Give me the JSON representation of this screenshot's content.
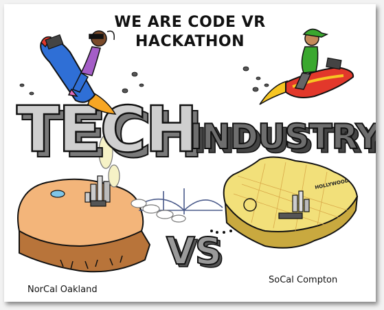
{
  "headline": {
    "line1": "WE ARE CODE VR",
    "line2": "HACKATHON"
  },
  "word_tech": "TECH",
  "word_industry": "INDUSTRY",
  "word_vs": "VS",
  "captions": {
    "left": "NorCal Oakland",
    "right": "SoCal Compton",
    "hollywood_sign": "HOLLYWOOD"
  },
  "colors": {
    "tech_face": "#cfcfcf",
    "industry_face": "#6e6e6e",
    "norcal_land": "#f3b57a",
    "norcal_side": "#b8743a",
    "socal_land": "#f2e07a",
    "socal_side": "#c9a93f",
    "rocket_blue": "#2f6fd6",
    "rocket_red": "#e2382b",
    "rocket_green": "#3aa82f"
  }
}
